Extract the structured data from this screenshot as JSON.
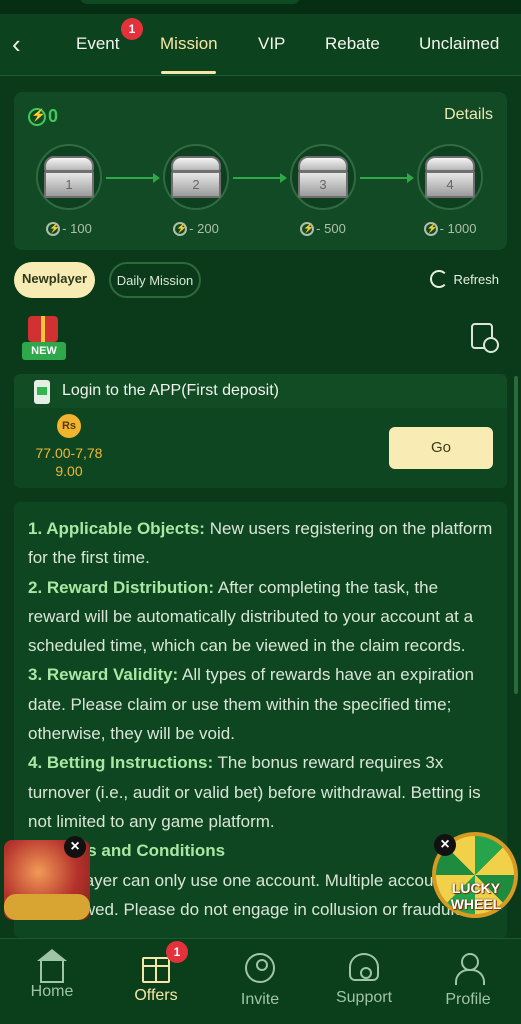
{
  "tabs": [
    {
      "label": "Event",
      "badge": "1"
    },
    {
      "label": "Mission",
      "active": true
    },
    {
      "label": "VIP"
    },
    {
      "label": "Rebate"
    },
    {
      "label": "Unclaimed"
    }
  ],
  "progress": {
    "points": "0",
    "details_label": "Details",
    "chests": [
      {
        "num": "1",
        "cost": "- 100"
      },
      {
        "num": "2",
        "cost": "- 200"
      },
      {
        "num": "3",
        "cost": "- 500"
      },
      {
        "num": "4",
        "cost": "- 1000"
      }
    ]
  },
  "filters": {
    "newplayer": "Newplayer",
    "daily": "Daily Mission",
    "refresh": "Refresh"
  },
  "new_badge": "NEW",
  "task": {
    "title": "Login to the APP(First deposit)",
    "currency": "Rs",
    "reward_line1": "77.00-7,78",
    "reward_line2": "9.00",
    "go_label": "Go"
  },
  "rules": [
    {
      "head": "1. Applicable Objects:",
      "text": " New users registering on the platform for the first time."
    },
    {
      "head": "2. Reward Distribution:",
      "text": " After completing the task, the reward will be automatically distributed to your account at a scheduled time, which can be viewed in the claim records."
    },
    {
      "head": "3. Reward Validity:",
      "text": " All types of rewards have an expiration date. Please claim or use them within the specified time; otherwise, they will be void."
    },
    {
      "head": "4. Betting Instructions:",
      "text": " The bonus reward requires 3x turnover (i.e., audit or valid bet) before withdrawal. Betting is not limited to any game platform."
    },
    {
      "head": "5. Terms and Conditions",
      "text": ""
    },
    {
      "head": "",
      "text": "Each player can only use one account. Multiple accounts are not allowed. Please do not engage in collusion or fraudulent"
    }
  ],
  "lucky_wheel": "LUCKY WHEEL",
  "bottom_nav": [
    {
      "label": "Home",
      "icon": "home-icon"
    },
    {
      "label": "Offers",
      "icon": "gift-icon",
      "badge": "1",
      "active": true
    },
    {
      "label": "Invite",
      "icon": "invite-icon"
    },
    {
      "label": "Support",
      "icon": "headset-icon"
    },
    {
      "label": "Profile",
      "icon": "profile-icon"
    }
  ],
  "colors": {
    "background": "#0a3a19",
    "accent": "#f6e7a6",
    "green": "#3fcb59",
    "gold": "#f0b830"
  }
}
